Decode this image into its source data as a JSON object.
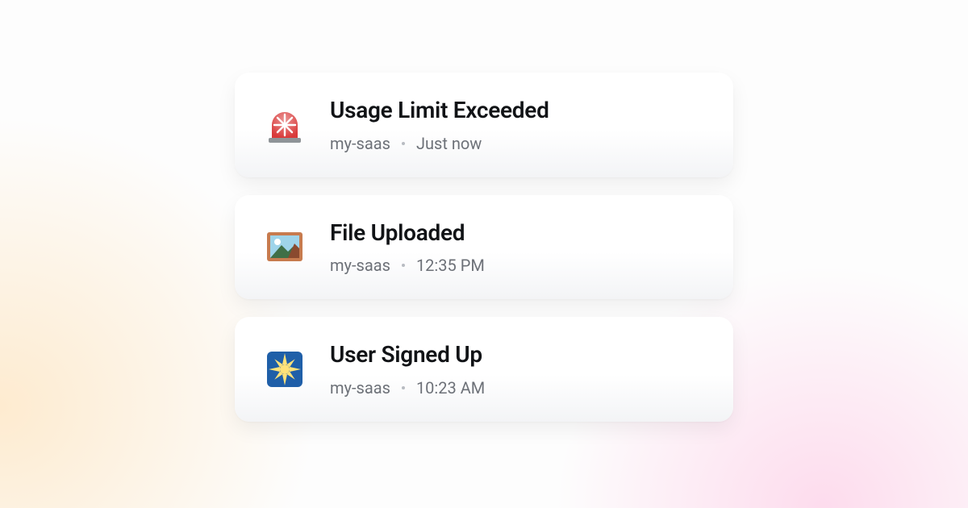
{
  "notifications": [
    {
      "icon": "siren-icon",
      "title": "Usage Limit Exceeded",
      "source": "my-saas",
      "time": "Just now"
    },
    {
      "icon": "picture-icon",
      "title": "File Uploaded",
      "source": "my-saas",
      "time": "12:35 PM"
    },
    {
      "icon": "sparkle-icon",
      "title": "User Signed Up",
      "source": "my-saas",
      "time": "10:23 AM"
    }
  ]
}
